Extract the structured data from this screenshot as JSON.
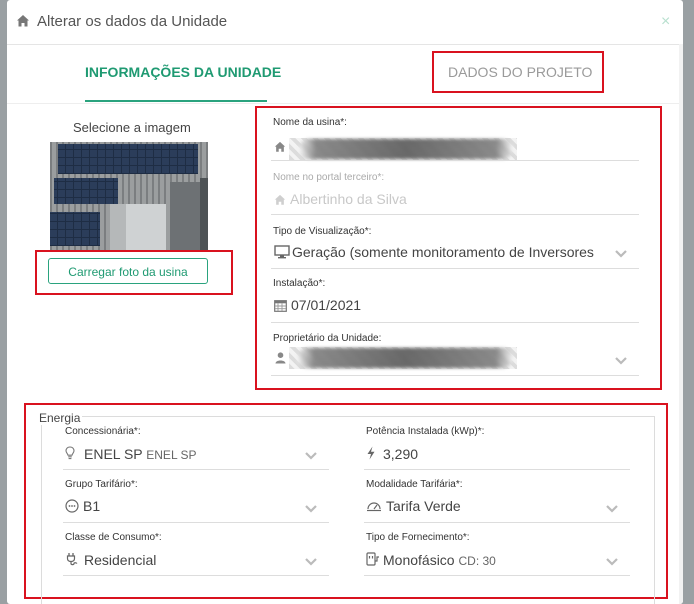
{
  "modal": {
    "title": "Alterar os dados da Unidade",
    "close_glyph": "×",
    "header_icon": "home-icon"
  },
  "tabs": [
    {
      "label": "INFORMAÇÕES DA UNIDADE",
      "active": true
    },
    {
      "label": "DADOS DO PROJETO",
      "active": false
    }
  ],
  "image_panel": {
    "label": "Selecione a imagem",
    "upload_button": "Carregar foto da usina"
  },
  "unit_fields": {
    "nome_usina": {
      "label": "Nome da usina*:",
      "icon": "home-icon"
    },
    "nome_portal": {
      "label": "Nome no portal terceiro*:",
      "value": "Albertinho da Silva",
      "icon": "home-icon"
    },
    "tipo_visualizacao": {
      "label": "Tipo de Visualização*:",
      "value": "Geração (somente monitoramento de Inversores",
      "icon": "monitor-icon"
    },
    "instalacao": {
      "label": "Instalação*:",
      "value": "07/01/2021",
      "icon": "calendar-icon"
    },
    "proprietario": {
      "label": "Proprietário da Unidade:",
      "icon": "user-icon"
    }
  },
  "energia": {
    "legend": "Energia",
    "concessionaria": {
      "label": "Concessionária*:",
      "value": "ENEL SP",
      "sub": "ENEL SP",
      "icon": "lightbulb-icon"
    },
    "potencia": {
      "label": "Potência Instalada (kWp)*:",
      "value": "3,290",
      "icon": "bolt-icon"
    },
    "grupo_tarifario": {
      "label": "Grupo Tarifário*:",
      "value": "B1",
      "icon": "meter-icon"
    },
    "modalidade_tarifaria": {
      "label": "Modalidade Tarifária*:",
      "value": "Tarifa Verde",
      "icon": "meter-icon"
    },
    "classe_consumo": {
      "label": "Classe de Consumo*:",
      "value": "Residencial",
      "icon": "plug-icon"
    },
    "tipo_fornecimento": {
      "label": "Tipo de Fornecimento*:",
      "value": "Monofásico",
      "sub": "CD: 30",
      "icon": "socket-icon"
    }
  },
  "colors": {
    "accent": "#2aa37e",
    "annotation_red": "#d9121f"
  }
}
